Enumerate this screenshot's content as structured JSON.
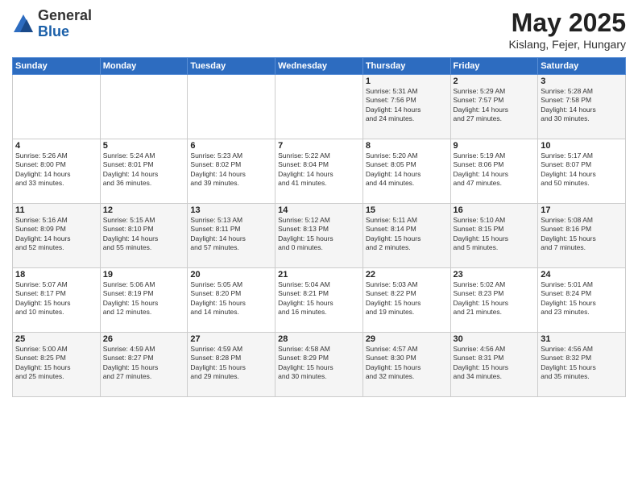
{
  "logo": {
    "general": "General",
    "blue": "Blue"
  },
  "title": "May 2025",
  "subtitle": "Kislang, Fejer, Hungary",
  "days_of_week": [
    "Sunday",
    "Monday",
    "Tuesday",
    "Wednesday",
    "Thursday",
    "Friday",
    "Saturday"
  ],
  "weeks": [
    [
      {
        "day": "",
        "info": ""
      },
      {
        "day": "",
        "info": ""
      },
      {
        "day": "",
        "info": ""
      },
      {
        "day": "",
        "info": ""
      },
      {
        "day": "1",
        "info": "Sunrise: 5:31 AM\nSunset: 7:56 PM\nDaylight: 14 hours\nand 24 minutes."
      },
      {
        "day": "2",
        "info": "Sunrise: 5:29 AM\nSunset: 7:57 PM\nDaylight: 14 hours\nand 27 minutes."
      },
      {
        "day": "3",
        "info": "Sunrise: 5:28 AM\nSunset: 7:58 PM\nDaylight: 14 hours\nand 30 minutes."
      }
    ],
    [
      {
        "day": "4",
        "info": "Sunrise: 5:26 AM\nSunset: 8:00 PM\nDaylight: 14 hours\nand 33 minutes."
      },
      {
        "day": "5",
        "info": "Sunrise: 5:24 AM\nSunset: 8:01 PM\nDaylight: 14 hours\nand 36 minutes."
      },
      {
        "day": "6",
        "info": "Sunrise: 5:23 AM\nSunset: 8:02 PM\nDaylight: 14 hours\nand 39 minutes."
      },
      {
        "day": "7",
        "info": "Sunrise: 5:22 AM\nSunset: 8:04 PM\nDaylight: 14 hours\nand 41 minutes."
      },
      {
        "day": "8",
        "info": "Sunrise: 5:20 AM\nSunset: 8:05 PM\nDaylight: 14 hours\nand 44 minutes."
      },
      {
        "day": "9",
        "info": "Sunrise: 5:19 AM\nSunset: 8:06 PM\nDaylight: 14 hours\nand 47 minutes."
      },
      {
        "day": "10",
        "info": "Sunrise: 5:17 AM\nSunset: 8:07 PM\nDaylight: 14 hours\nand 50 minutes."
      }
    ],
    [
      {
        "day": "11",
        "info": "Sunrise: 5:16 AM\nSunset: 8:09 PM\nDaylight: 14 hours\nand 52 minutes."
      },
      {
        "day": "12",
        "info": "Sunrise: 5:15 AM\nSunset: 8:10 PM\nDaylight: 14 hours\nand 55 minutes."
      },
      {
        "day": "13",
        "info": "Sunrise: 5:13 AM\nSunset: 8:11 PM\nDaylight: 14 hours\nand 57 minutes."
      },
      {
        "day": "14",
        "info": "Sunrise: 5:12 AM\nSunset: 8:13 PM\nDaylight: 15 hours\nand 0 minutes."
      },
      {
        "day": "15",
        "info": "Sunrise: 5:11 AM\nSunset: 8:14 PM\nDaylight: 15 hours\nand 2 minutes."
      },
      {
        "day": "16",
        "info": "Sunrise: 5:10 AM\nSunset: 8:15 PM\nDaylight: 15 hours\nand 5 minutes."
      },
      {
        "day": "17",
        "info": "Sunrise: 5:08 AM\nSunset: 8:16 PM\nDaylight: 15 hours\nand 7 minutes."
      }
    ],
    [
      {
        "day": "18",
        "info": "Sunrise: 5:07 AM\nSunset: 8:17 PM\nDaylight: 15 hours\nand 10 minutes."
      },
      {
        "day": "19",
        "info": "Sunrise: 5:06 AM\nSunset: 8:19 PM\nDaylight: 15 hours\nand 12 minutes."
      },
      {
        "day": "20",
        "info": "Sunrise: 5:05 AM\nSunset: 8:20 PM\nDaylight: 15 hours\nand 14 minutes."
      },
      {
        "day": "21",
        "info": "Sunrise: 5:04 AM\nSunset: 8:21 PM\nDaylight: 15 hours\nand 16 minutes."
      },
      {
        "day": "22",
        "info": "Sunrise: 5:03 AM\nSunset: 8:22 PM\nDaylight: 15 hours\nand 19 minutes."
      },
      {
        "day": "23",
        "info": "Sunrise: 5:02 AM\nSunset: 8:23 PM\nDaylight: 15 hours\nand 21 minutes."
      },
      {
        "day": "24",
        "info": "Sunrise: 5:01 AM\nSunset: 8:24 PM\nDaylight: 15 hours\nand 23 minutes."
      }
    ],
    [
      {
        "day": "25",
        "info": "Sunrise: 5:00 AM\nSunset: 8:25 PM\nDaylight: 15 hours\nand 25 minutes."
      },
      {
        "day": "26",
        "info": "Sunrise: 4:59 AM\nSunset: 8:27 PM\nDaylight: 15 hours\nand 27 minutes."
      },
      {
        "day": "27",
        "info": "Sunrise: 4:59 AM\nSunset: 8:28 PM\nDaylight: 15 hours\nand 29 minutes."
      },
      {
        "day": "28",
        "info": "Sunrise: 4:58 AM\nSunset: 8:29 PM\nDaylight: 15 hours\nand 30 minutes."
      },
      {
        "day": "29",
        "info": "Sunrise: 4:57 AM\nSunset: 8:30 PM\nDaylight: 15 hours\nand 32 minutes."
      },
      {
        "day": "30",
        "info": "Sunrise: 4:56 AM\nSunset: 8:31 PM\nDaylight: 15 hours\nand 34 minutes."
      },
      {
        "day": "31",
        "info": "Sunrise: 4:56 AM\nSunset: 8:32 PM\nDaylight: 15 hours\nand 35 minutes."
      }
    ]
  ]
}
